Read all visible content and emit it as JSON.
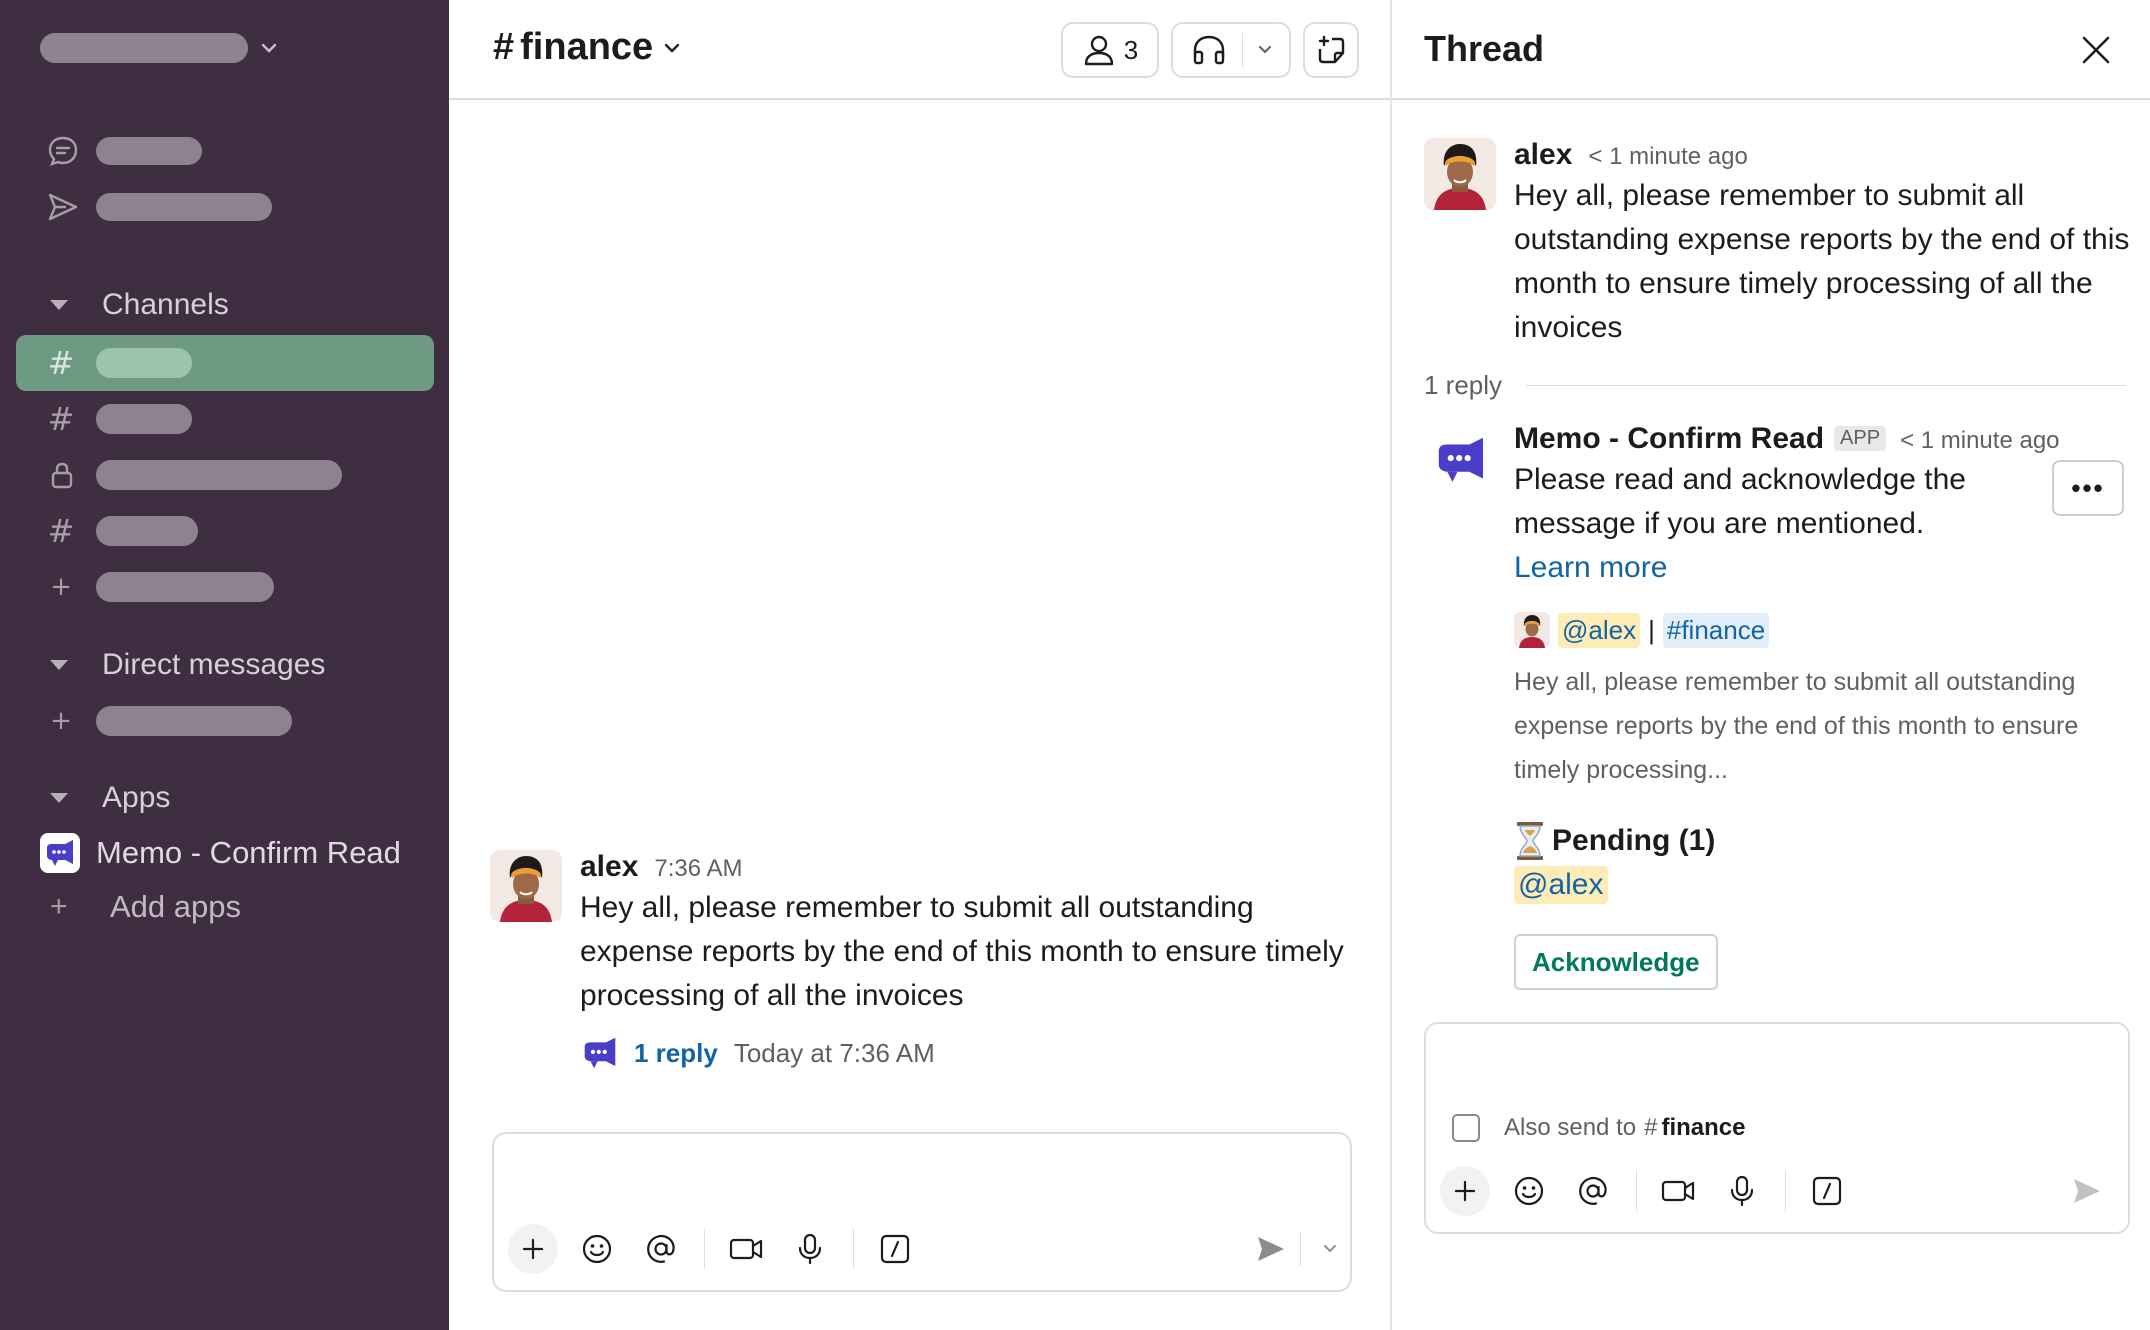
{
  "sidebar": {
    "sections": {
      "channels": "Channels",
      "direct_messages": "Direct messages",
      "apps": "Apps"
    },
    "apps": [
      {
        "label": "Memo - Confirm Read",
        "icon": "megaphone-icon"
      }
    ],
    "add_apps": "Add apps"
  },
  "channel": {
    "name": "finance",
    "member_count": "3"
  },
  "messages": [
    {
      "sender": "alex",
      "time": "7:36 AM",
      "text": "Hey all, please remember to submit all outstanding expense reports by the end of this month to ensure timely processing of all the invoices",
      "reply_count_label": "1 reply",
      "reply_time": "Today at 7:36 AM"
    }
  ],
  "thread": {
    "title": "Thread",
    "parent": {
      "sender": "alex",
      "time": "< 1 minute ago",
      "text": "Hey all, please remember to submit all outstanding expense reports by the end of this month to ensure timely processing of all the invoices"
    },
    "reply_divider": "1 reply",
    "reply": {
      "sender": "Memo - Confirm Read",
      "badge": "APP",
      "time": "< 1 minute ago",
      "text_before_link": "Please read and acknowledge the message if you are mentioned.",
      "link_text": "Learn more",
      "mention": "@alex",
      "separator": "|",
      "channel_mention": "#finance",
      "preview": "Hey all, please remember to submit all outstanding expense reports by the end of this month to ensure timely processing...",
      "pending_label": "Pending (1)",
      "pending_mention": "@alex",
      "acknowledge_button": "Acknowledge"
    },
    "composer": {
      "also_send_label": "Also send to",
      "also_send_channel": "finance"
    }
  },
  "colors": {
    "sidebar_bg": "#3f2e42",
    "active_channel": "#6e9a84",
    "link": "#1264a3",
    "acknowledge_green": "#007a5a",
    "mention_highlight": "#fdebb8",
    "app_purple": "#4a3ec9"
  }
}
